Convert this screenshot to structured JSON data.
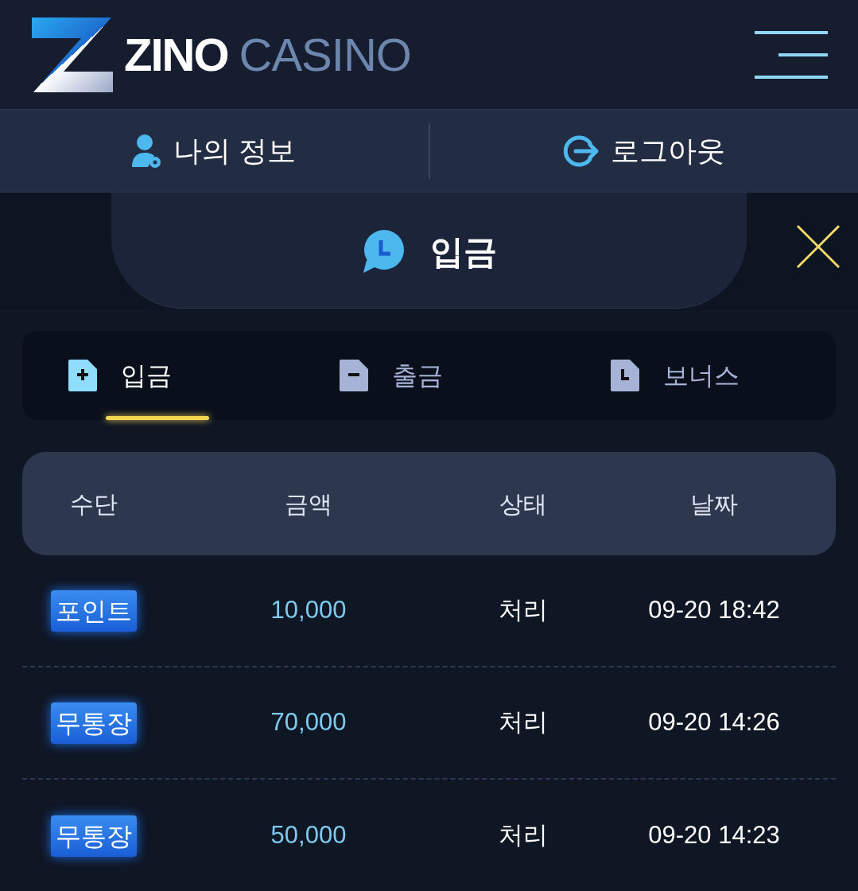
{
  "logo": {
    "word_1": "ZINO",
    "word_2": "CASINO"
  },
  "nav": [
    {
      "label": "나의 정보"
    },
    {
      "label": "로그아웃"
    }
  ],
  "panel_title": "입금",
  "tabs": [
    {
      "label": "입금",
      "selected": true
    },
    {
      "label": "출금",
      "selected": false
    },
    {
      "label": "보너스",
      "selected": false
    }
  ],
  "table": {
    "columns": [
      "수단",
      "금액",
      "상태",
      "날짜"
    ],
    "rows": [
      {
        "method": "포인트",
        "amount": "10,000",
        "status": "처리",
        "date": "09-20 18:42"
      },
      {
        "method": "무통장",
        "amount": "70,000",
        "status": "처리",
        "date": "09-20 14:26"
      },
      {
        "method": "무통장",
        "amount": "50,000",
        "status": "처리",
        "date": "09-20 14:23"
      }
    ]
  }
}
